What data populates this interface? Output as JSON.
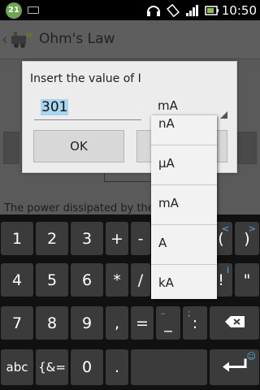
{
  "status_bar": {
    "badge": "21",
    "time": "10:50",
    "icons": [
      "keyboard-icon",
      "headset-icon",
      "rotation-lock-icon",
      "signal-icon",
      "battery-icon"
    ]
  },
  "app": {
    "title": "Ohm's Law",
    "power_text": "The power dissipated by the"
  },
  "dialog": {
    "title": "Insert the value of I",
    "input_value": "301",
    "unit_selected": "mA",
    "ok_label": "OK"
  },
  "dropdown": {
    "options": [
      "nA",
      "μA",
      "mA",
      "A",
      "kA"
    ]
  },
  "keyboard": {
    "row1": [
      "1",
      "2",
      "3",
      "+",
      "-",
      "(",
      ")"
    ],
    "row1_subs": {
      "paren_open": "<",
      "paren_close": ">"
    },
    "row2": [
      "4",
      "5",
      "6",
      "*",
      "/",
      "!",
      "\""
    ],
    "row2_subs": {
      "excl": "i"
    },
    "row3": [
      "7",
      "8",
      "9",
      ",",
      "=",
      "_",
      ":"
    ],
    "row3_subs": {
      "underscore": "–",
      "colon": ";"
    },
    "row4": [
      "abc",
      "{&=",
      "0",
      "."
    ],
    "enter_sub": "☺"
  },
  "colors": {
    "accent": "#4ab3e0",
    "selection": "#a9d6ef",
    "key_bg": "#3b3b3b"
  }
}
